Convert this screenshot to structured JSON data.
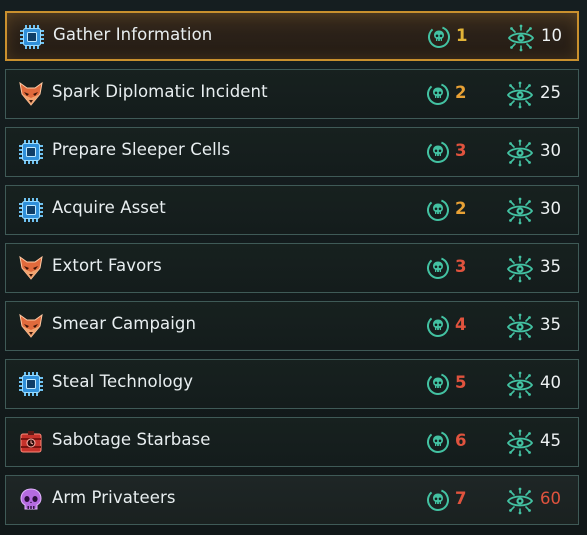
{
  "operations": [
    {
      "name": "Gather Information",
      "category": "tech-chip-icon",
      "difficulty": "1",
      "difficulty_color": "#e2b437",
      "cost": "10",
      "cost_color": "#eef2f3",
      "selected": true
    },
    {
      "name": "Spark Diplomatic Incident",
      "category": "fox-mask-icon",
      "difficulty": "2",
      "difficulty_color": "#e8a135",
      "cost": "25",
      "cost_color": "#eef2f3",
      "selected": false
    },
    {
      "name": "Prepare Sleeper Cells",
      "category": "tech-chip-icon",
      "difficulty": "3",
      "difficulty_color": "#e0533e",
      "cost": "30",
      "cost_color": "#eef2f3",
      "selected": false
    },
    {
      "name": "Acquire Asset",
      "category": "tech-chip-icon",
      "difficulty": "2",
      "difficulty_color": "#e8a135",
      "cost": "30",
      "cost_color": "#eef2f3",
      "selected": false
    },
    {
      "name": "Extort Favors",
      "category": "fox-mask-icon",
      "difficulty": "3",
      "difficulty_color": "#e0533e",
      "cost": "35",
      "cost_color": "#eef2f3",
      "selected": false
    },
    {
      "name": "Smear Campaign",
      "category": "fox-mask-icon",
      "difficulty": "4",
      "difficulty_color": "#e0533e",
      "cost": "35",
      "cost_color": "#eef2f3",
      "selected": false
    },
    {
      "name": "Steal Technology",
      "category": "tech-chip-icon",
      "difficulty": "5",
      "difficulty_color": "#e0533e",
      "cost": "40",
      "cost_color": "#eef2f3",
      "selected": false
    },
    {
      "name": "Sabotage Starbase",
      "category": "explosive-icon",
      "difficulty": "6",
      "difficulty_color": "#e0533e",
      "cost": "45",
      "cost_color": "#eef2f3",
      "selected": false
    },
    {
      "name": "Arm Privateers",
      "category": "skull-icon",
      "difficulty": "7",
      "difficulty_color": "#e0533e",
      "cost": "60",
      "cost_color": "#e0533e",
      "selected": false
    }
  ],
  "icons": {
    "difficulty": "difficulty-skull-icon",
    "cost": "infiltration-eye-icon"
  }
}
